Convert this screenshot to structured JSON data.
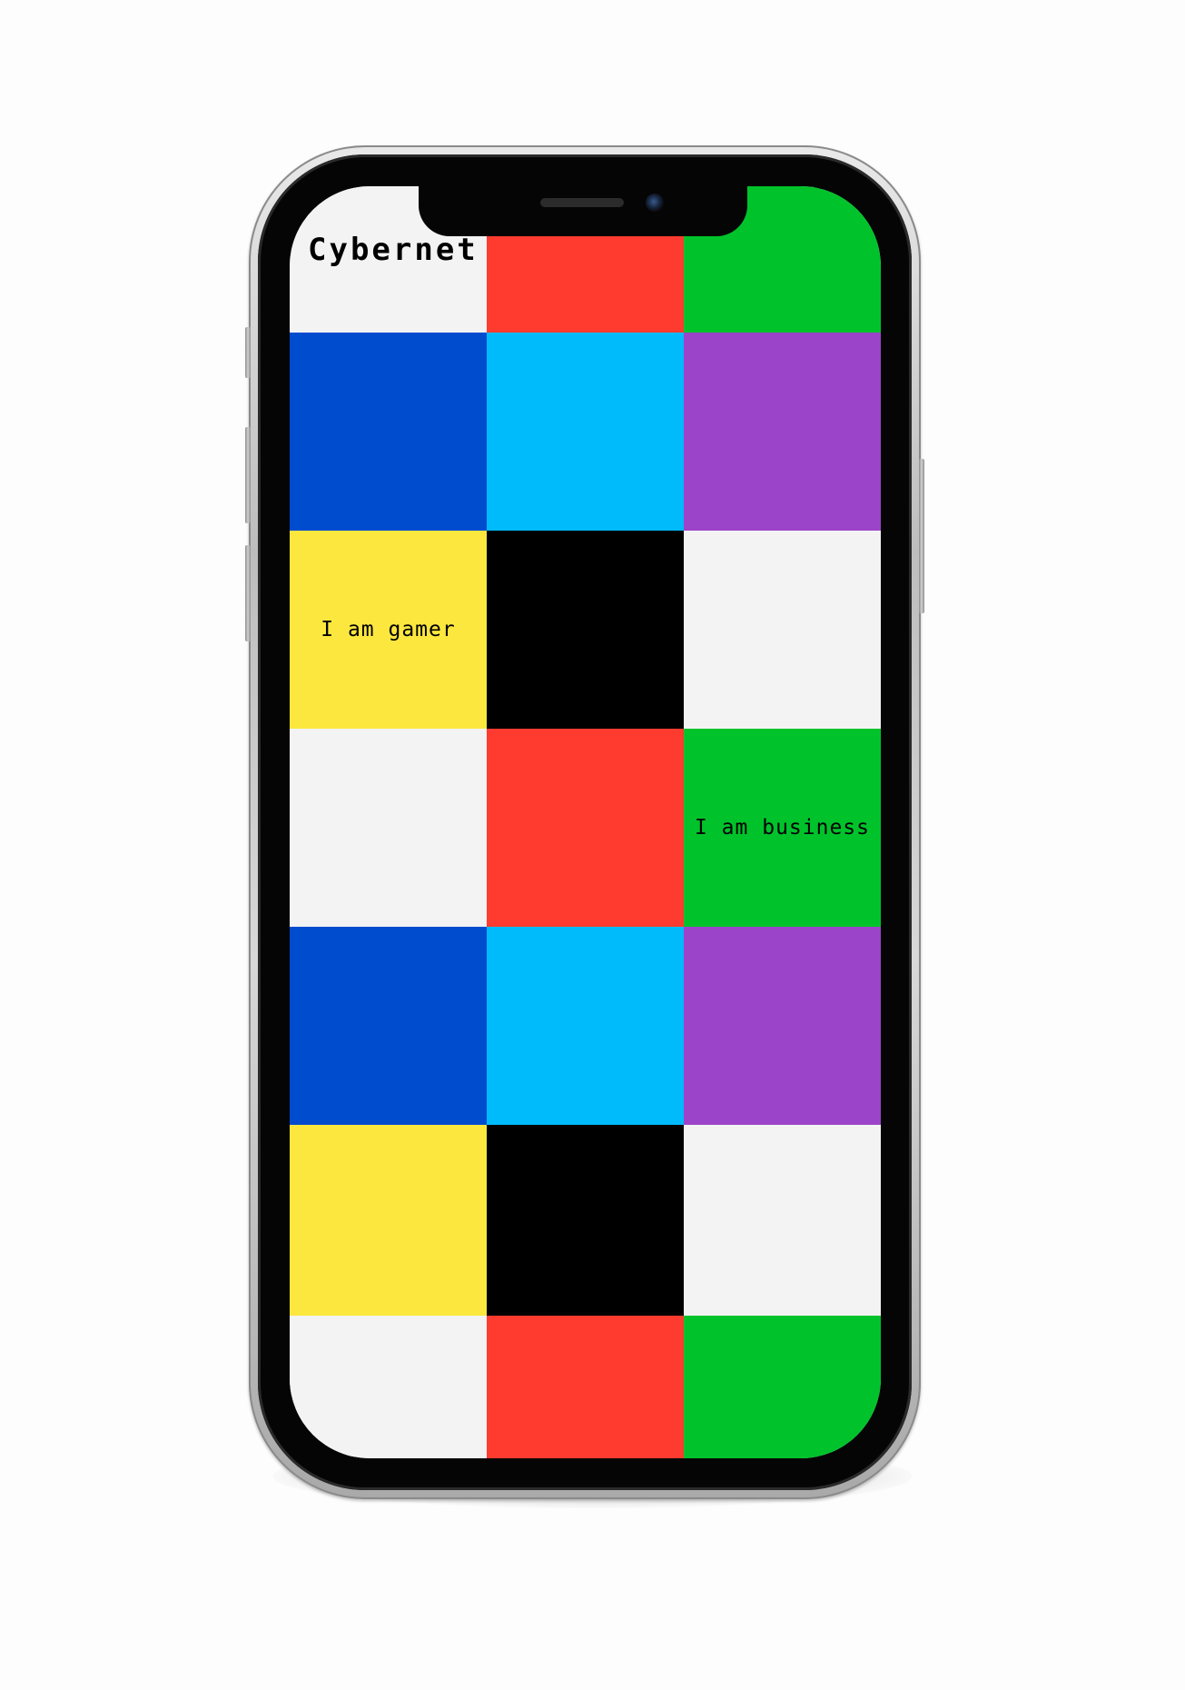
{
  "app": {
    "title": "Cybernet"
  },
  "colors": {
    "white": "#f3f3f3",
    "red": "#ff3b2f",
    "green": "#00c32b",
    "blue": "#004ccf",
    "cyan": "#00bbfc",
    "purple": "#9c44c9",
    "yellow": "#fce73f",
    "black": "#000000"
  },
  "tiles": [
    {
      "color": "#f3f3f3",
      "label": ""
    },
    {
      "color": "#ff3b2f",
      "label": ""
    },
    {
      "color": "#00c32b",
      "label": ""
    },
    {
      "color": "#004ccf",
      "label": ""
    },
    {
      "color": "#00bbfc",
      "label": ""
    },
    {
      "color": "#9c44c9",
      "label": ""
    },
    {
      "color": "#fce73f",
      "label": "I am gamer"
    },
    {
      "color": "#000000",
      "label": ""
    },
    {
      "color": "#f3f3f3",
      "label": ""
    },
    {
      "color": "#f3f3f3",
      "label": ""
    },
    {
      "color": "#ff3b2f",
      "label": ""
    },
    {
      "color": "#00c32b",
      "label": "I am business"
    },
    {
      "color": "#004ccf",
      "label": ""
    },
    {
      "color": "#00bbfc",
      "label": ""
    },
    {
      "color": "#9c44c9",
      "label": ""
    },
    {
      "color": "#fce73f",
      "label": ""
    },
    {
      "color": "#000000",
      "label": ""
    },
    {
      "color": "#f3f3f3",
      "label": ""
    },
    {
      "color": "#f3f3f3",
      "label": ""
    },
    {
      "color": "#ff3b2f",
      "label": ""
    },
    {
      "color": "#00c32b",
      "label": ""
    }
  ],
  "device": {
    "icons": [
      "speaker-icon",
      "front-camera-icon"
    ]
  }
}
